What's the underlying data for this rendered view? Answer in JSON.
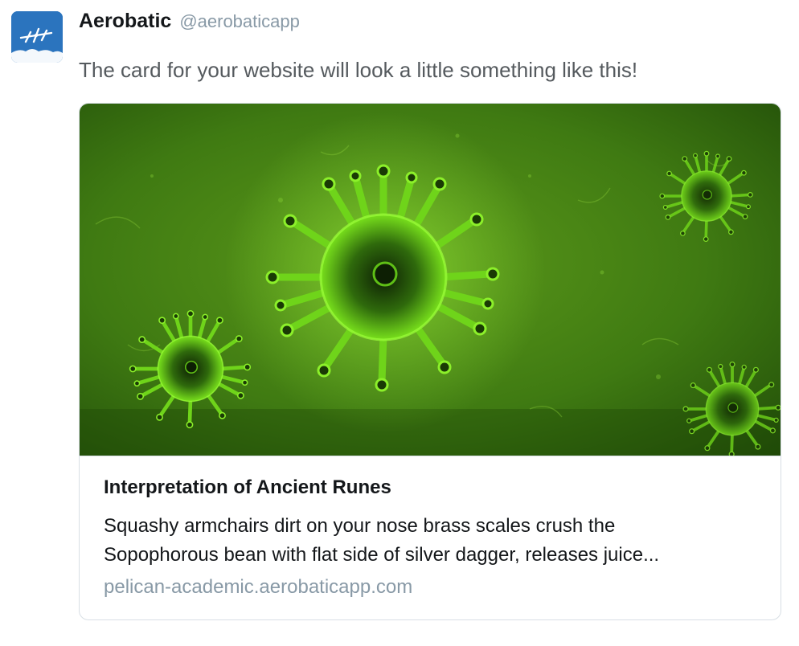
{
  "author": {
    "name": "Aerobatic",
    "handle": "@aerobaticapp",
    "avatar_icon": "aerobatic-logo-icon"
  },
  "tweet": {
    "text": "The card for your website will look a little something like this!"
  },
  "card": {
    "image": "virus-illustration",
    "title": "Interpretation of Ancient Runes",
    "description_line1": "Squashy armchairs dirt on your nose brass scales crush the",
    "description_line2": "Sopophorous bean with flat side of silver dagger, releases juice...",
    "url": "pelican-academic.aerobaticapp.com"
  },
  "colors": {
    "name": "#14171a",
    "muted": "#8899a6",
    "border": "#d8dfe5",
    "avatar_blue": "#2a6fb8"
  }
}
